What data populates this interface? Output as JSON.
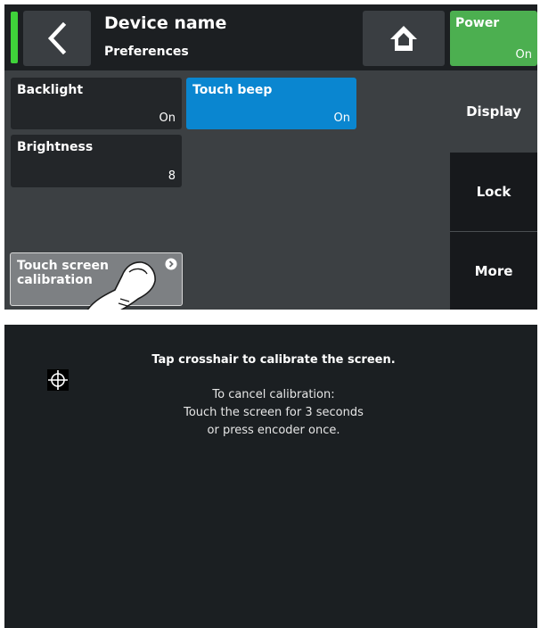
{
  "header": {
    "title": "Device name",
    "subtitle": "Preferences",
    "power": {
      "label": "Power",
      "value": "On"
    }
  },
  "tiles": [
    {
      "label": "Backlight",
      "value": "On"
    },
    {
      "label": "Touch beep",
      "value": "On"
    },
    {
      "label": "Brightness",
      "value": "8"
    },
    {
      "label": "Touch screen calibration"
    }
  ],
  "side_tabs": [
    "Display",
    "Lock",
    "More"
  ],
  "calibration": {
    "instruction": "Tap crosshair to calibrate the screen.",
    "cancel_lines": [
      "To cancel calibration:",
      "Touch the screen for 3 seconds",
      "or press encoder once."
    ]
  },
  "colors": {
    "accent_blue": "#0a86d0",
    "power_green": "#4caf50",
    "led_green": "#3fd23a"
  }
}
